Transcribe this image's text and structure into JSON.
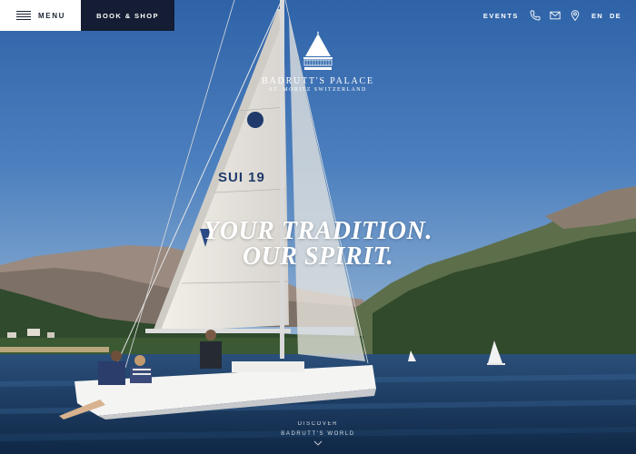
{
  "header": {
    "menu_label": "MENU",
    "book_label": "BOOK & SHOP",
    "events_label": "EVENTS",
    "icons": [
      "phone-icon",
      "mail-icon",
      "location-pin-icon"
    ],
    "languages": [
      "EN",
      "DE"
    ]
  },
  "brand": {
    "name": "BADRUTT'S PALACE",
    "subtitle": "ST. MORITZ SWITZERLAND",
    "mark_lettering": [
      "EST.",
      "1896"
    ]
  },
  "hero": {
    "headline_line1": "YOUR TRADITION.",
    "headline_line2": "OUR SPIRIT.",
    "sail_number": "SUI 19",
    "discover_line1": "DISCOVER",
    "discover_line2": "BADRUTT'S WORLD"
  },
  "colors": {
    "menu_bg": "#ffffff",
    "book_bg": "#141d33",
    "text_light": "#ffffff",
    "text_dark": "#1a2233"
  }
}
